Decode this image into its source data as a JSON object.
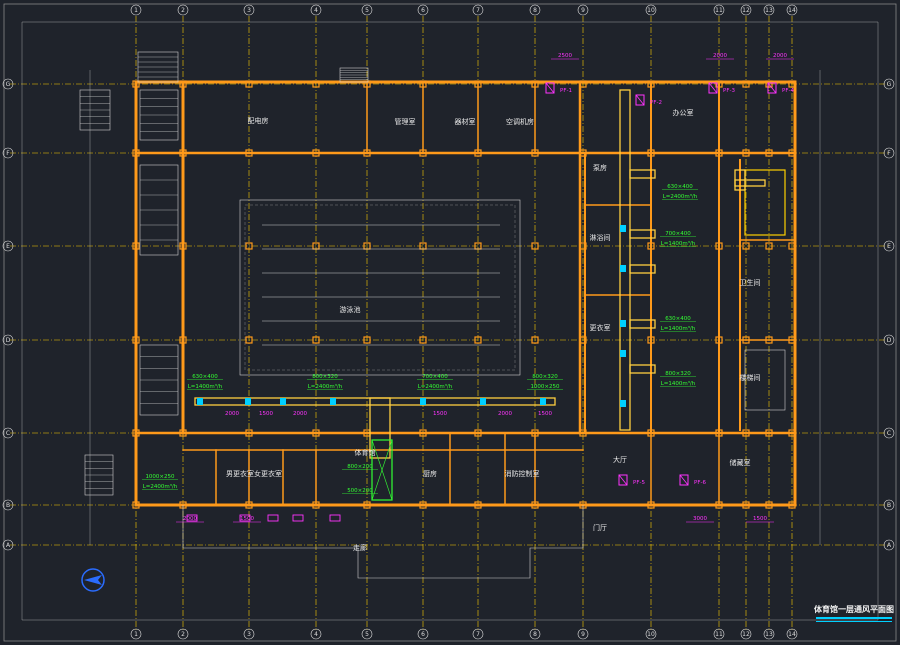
{
  "drawing": {
    "title": "体育馆一层通风平面图",
    "grid_columns": [
      "1",
      "2",
      "3",
      "4",
      "5",
      "6",
      "7",
      "8",
      "9",
      "10",
      "11",
      "12",
      "13",
      "14"
    ],
    "grid_rows": [
      "A",
      "B",
      "C",
      "D",
      "E",
      "F",
      "G"
    ],
    "rooms": [
      "配电房",
      "管理室",
      "器材室",
      "空调机房",
      "游泳池",
      "体育馆",
      "泵房",
      "淋浴间",
      "更衣室",
      "办公室",
      "男更衣室",
      "女更衣室",
      "厨房",
      "大厅",
      "门厅",
      "卫生间",
      "消防控制室",
      "储藏室",
      "楼梯间",
      "走廊"
    ],
    "fans": [
      "PF-1",
      "PF-2",
      "PF-3",
      "PF-4",
      "PF-5",
      "PF-6"
    ],
    "duct_labels": [
      "630×400",
      "800×320",
      "700×400",
      "L=2400m³/h",
      "L=1400m³/h",
      "1000×250",
      "800×200",
      "500×200"
    ],
    "dimensions": [
      "2500",
      "2000",
      "1500",
      "3000"
    ],
    "colors": {
      "background": "#1f232b",
      "grid": "#ffd000",
      "walls": "#ff9a1a",
      "ducts": "#ffcf40",
      "annotations": "#33ff33",
      "equipment": "#ff33ff",
      "column_bubble": "#dddddd",
      "title_bar": "#00d0ff"
    }
  }
}
